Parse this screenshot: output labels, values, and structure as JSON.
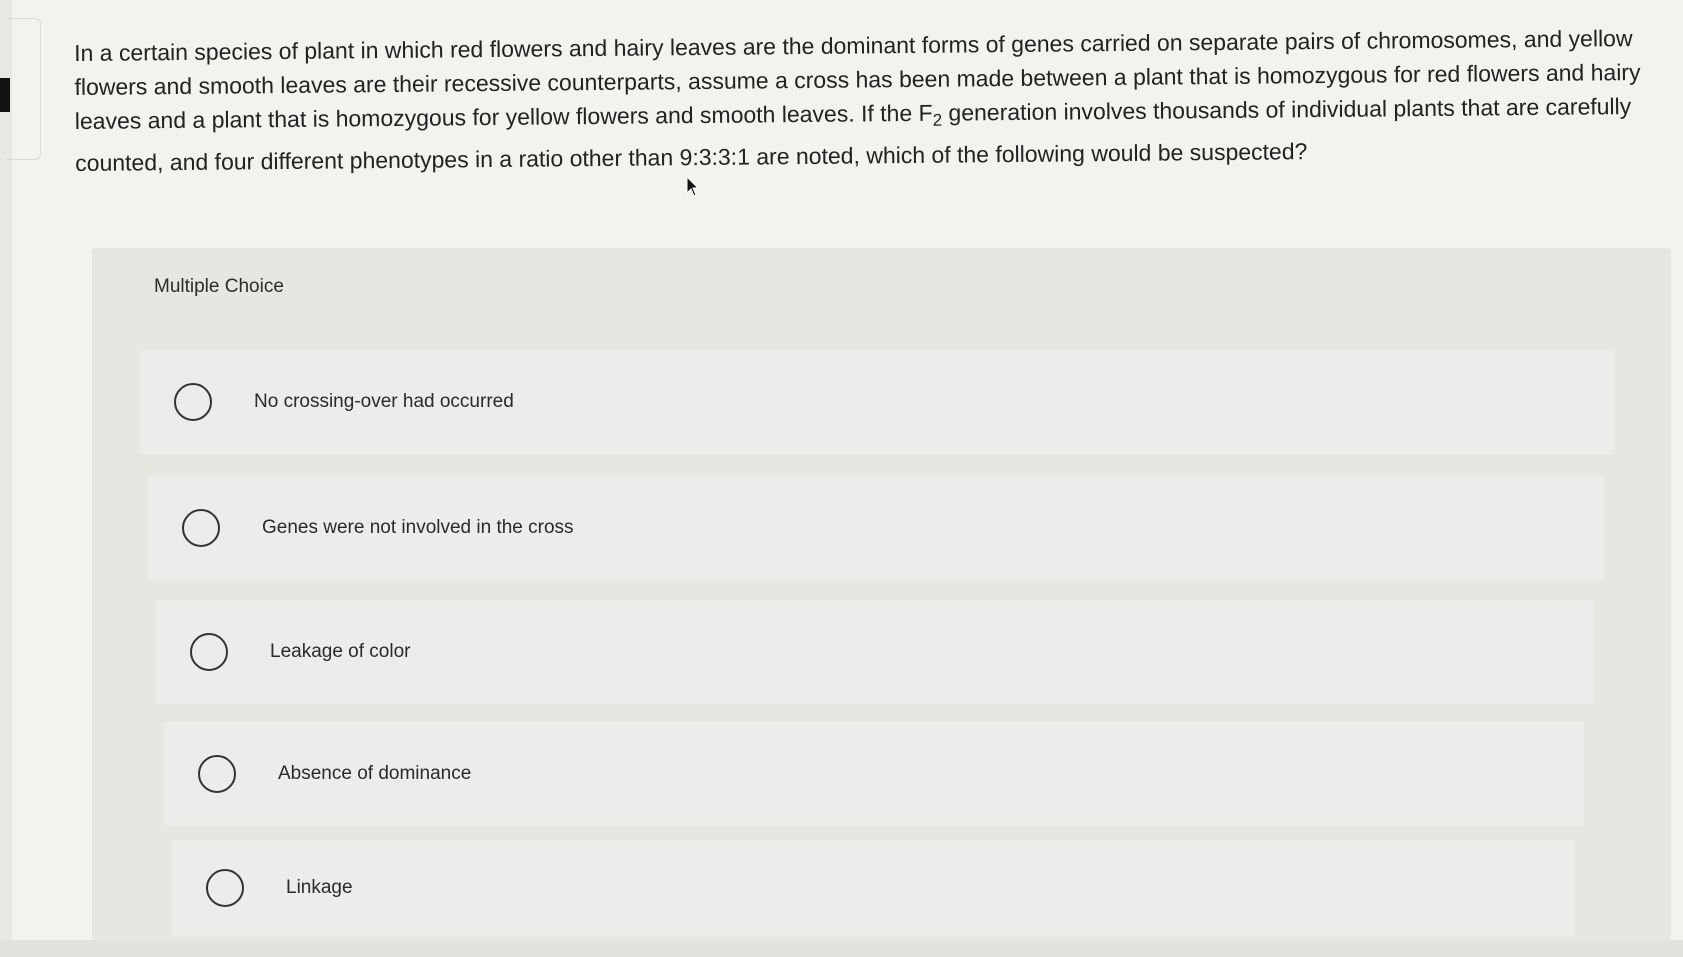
{
  "question": {
    "text_before_sub": "In a certain species of plant in which red flowers and hairy leaves are the dominant forms of genes carried on separate pairs of chromosomes, and yellow flowers and smooth leaves are their recessive counterparts, assume a cross has been made between a plant that is homozygous for red flowers and hairy leaves and a plant that is homozygous for yellow flowers and smooth leaves. If the F",
    "subscript": "2",
    "text_after_sub": " generation involves thousands of individual plants that are carefully counted, and four different phenotypes in a ratio other than 9:3:3:1 are noted, which of the following would be suspected?"
  },
  "multiple_choice": {
    "header": "Multiple Choice",
    "options": [
      {
        "label": "No crossing-over had occurred",
        "selected": false
      },
      {
        "label": "Genes were not involved in the cross",
        "selected": false
      },
      {
        "label": "Leakage of color",
        "selected": false
      },
      {
        "label": "Absence of dominance",
        "selected": false
      },
      {
        "label": "Linkage",
        "selected": false
      }
    ]
  },
  "icons": {
    "cursor": "mouse-pointer-icon",
    "radio": "radio-button-icon"
  }
}
